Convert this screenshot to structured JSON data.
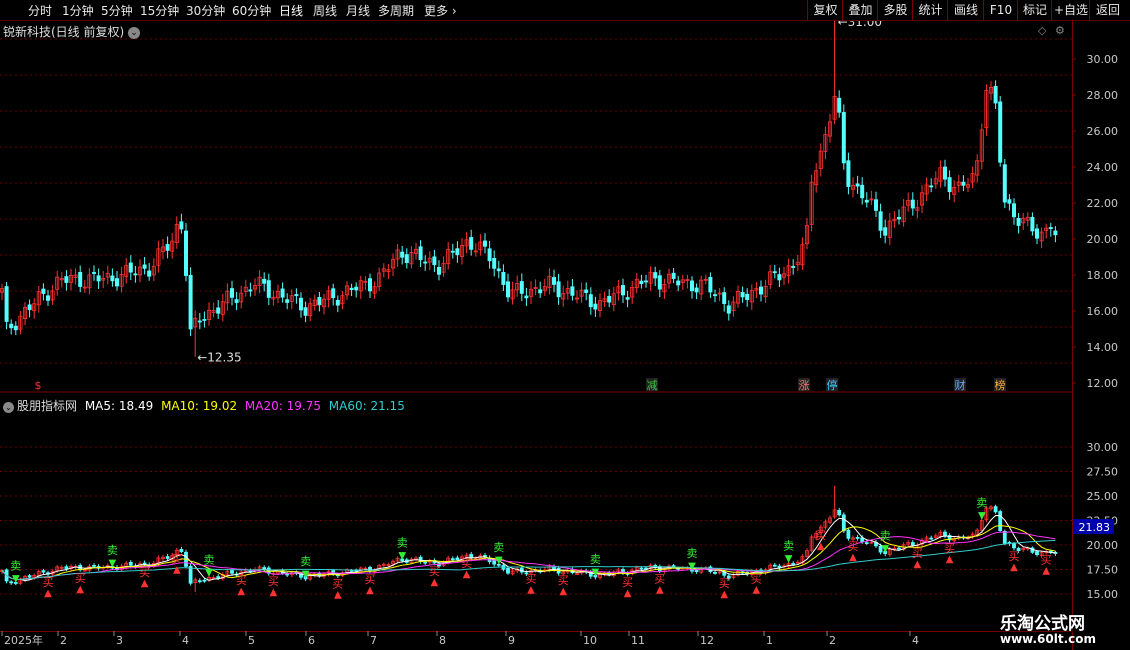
{
  "periods": [
    "分时",
    "1分钟",
    "5分钟",
    "15分钟",
    "30分钟",
    "60分钟",
    "日线",
    "周线",
    "月线",
    "多周期",
    "更多"
  ],
  "active_period": "日线",
  "toolbar": [
    "复权",
    "叠加",
    "多股",
    "统计",
    "画线",
    "F10",
    "标记",
    "+自选",
    "返回"
  ],
  "stock_title": "锐新科技(日线 前复权)",
  "indicator": {
    "name": "股朋指标网",
    "ma": [
      {
        "label": "MA5: 18.49",
        "color": "#ffffff"
      },
      {
        "label": "MA10: 19.02",
        "color": "#ffff00"
      },
      {
        "label": "MA20: 19.75",
        "color": "#ff33ff"
      },
      {
        "label": "MA60: 21.15",
        "color": "#33cccc"
      }
    ]
  },
  "price_axis": [
    "30.00",
    "28.00",
    "26.00",
    "24.00",
    "22.00",
    "20.00",
    "18.00",
    "16.00",
    "14.00",
    "12.00"
  ],
  "indicator_axis": [
    "30.00",
    "27.50",
    "25.00",
    "22.50",
    "20.00",
    "17.50",
    "15.00"
  ],
  "indicator_current_value": "21.83",
  "annotations": {
    "high": "31.00",
    "low": "12.35"
  },
  "event_markers": [
    "$",
    "减",
    "涨",
    "停",
    "财",
    "榜"
  ],
  "buy_label": "买",
  "sell_label": "卖",
  "date_axis": [
    "2025年",
    "2",
    "3",
    "4",
    "5",
    "6",
    "7",
    "8",
    "9",
    "10",
    "11",
    "12",
    "1",
    "2",
    "4"
  ],
  "watermark": {
    "title": "乐淘公式网",
    "url": "www.60lt.com"
  },
  "colors": {
    "up": "#ff3232",
    "down": "#54ffff",
    "sell": "#33ee33",
    "grid": "#6a0000",
    "background": "#000000"
  }
}
